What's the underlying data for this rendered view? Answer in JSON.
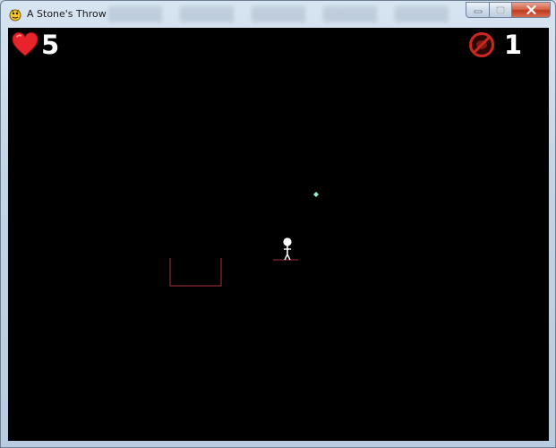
{
  "window": {
    "title": "A Stone's Throw",
    "app_icon": "pygame-snake-icon",
    "controls": [
      "minimize",
      "maximize",
      "close"
    ]
  },
  "hud": {
    "lives": {
      "icon": "heart-icon",
      "value": "5",
      "color": "#e8232a"
    },
    "stones": {
      "icon": "no-stone-icon",
      "value": "1",
      "color": "#c8281e"
    }
  },
  "scene": {
    "background": "#000000",
    "stone_color": "#8ff0d8",
    "player_color": "#ffffff",
    "platform_color": "#a0303a",
    "basket_color": "#8a2a34"
  }
}
